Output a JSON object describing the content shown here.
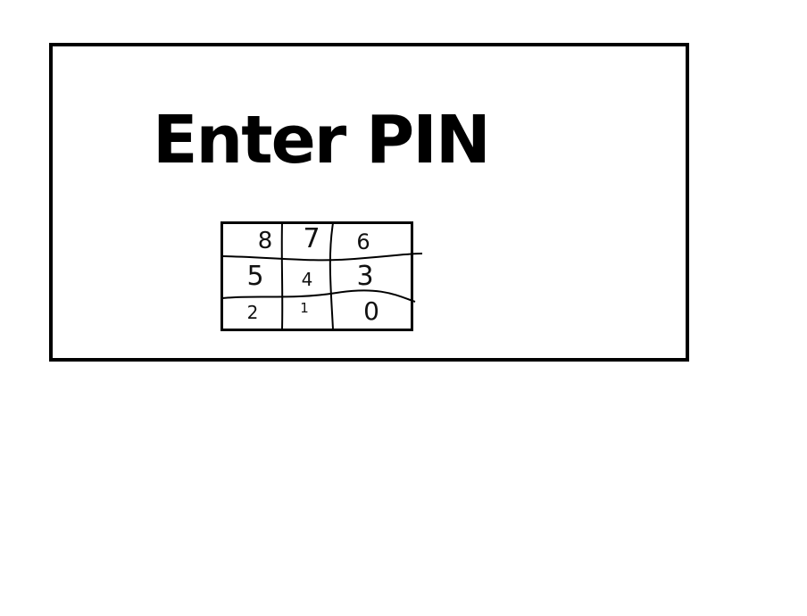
{
  "dialog": {
    "title": "Enter PIN"
  },
  "keypad": {
    "keys": [
      {
        "label": "8"
      },
      {
        "label": "7"
      },
      {
        "label": "6"
      },
      {
        "label": "5"
      },
      {
        "label": "4"
      },
      {
        "label": "3"
      },
      {
        "label": "2"
      },
      {
        "label": "1"
      },
      {
        "label": "0"
      }
    ]
  }
}
